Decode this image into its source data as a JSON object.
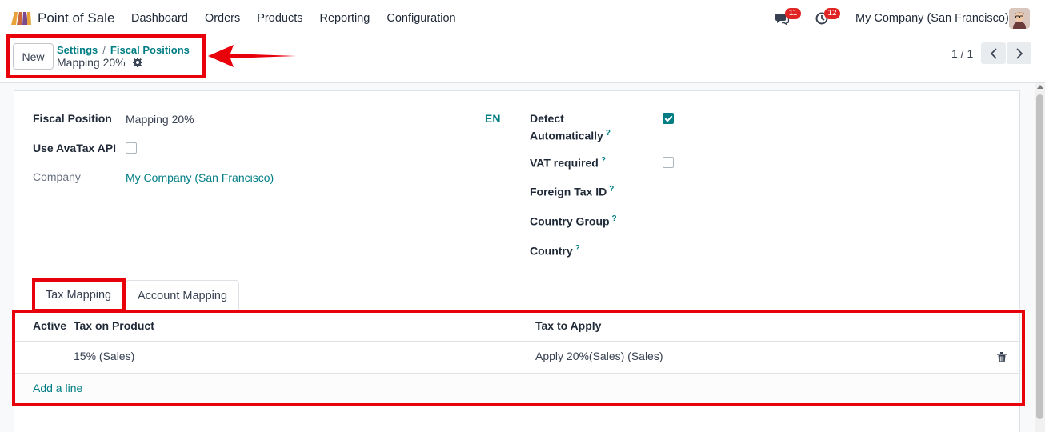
{
  "navbar": {
    "app_name": "Point of Sale",
    "menu": [
      "Dashboard",
      "Orders",
      "Products",
      "Reporting",
      "Configuration"
    ],
    "chat_badge": "11",
    "activity_badge": "12",
    "company": "My Company (San Francisco)"
  },
  "control": {
    "new_label": "New",
    "breadcrumb": [
      "Settings",
      "Fiscal Positions"
    ],
    "breadcrumb_sep": "/",
    "record_name": "Mapping 20%",
    "pager": "1 / 1"
  },
  "form": {
    "fiscal_position_label": "Fiscal Position",
    "fiscal_position_value": "Mapping 20%",
    "lang": "EN",
    "avatax_label": "Use AvaTax API",
    "avatax_checked": false,
    "company_label": "Company",
    "company_value": "My Company (San Francisco)",
    "detect_label_1": "Detect",
    "detect_label_2": "Automatically",
    "detect_checked": true,
    "vat_label": "VAT required",
    "vat_checked": false,
    "foreign_tax_label": "Foreign Tax ID",
    "country_group_label": "Country Group",
    "country_label": "Country",
    "help_mark": "?"
  },
  "tabs": [
    "Tax Mapping",
    "Account Mapping"
  ],
  "table": {
    "headers": [
      "Active",
      "Tax on Product",
      "Tax to Apply"
    ],
    "rows": [
      {
        "tax_on_product": "15% (Sales)",
        "tax_to_apply": "Apply 20%(Sales) (Sales)"
      }
    ],
    "add_line": "Add a line"
  },
  "colors": {
    "accent": "#017e84",
    "annotation": "#e8000b",
    "badge": "#e02424"
  }
}
